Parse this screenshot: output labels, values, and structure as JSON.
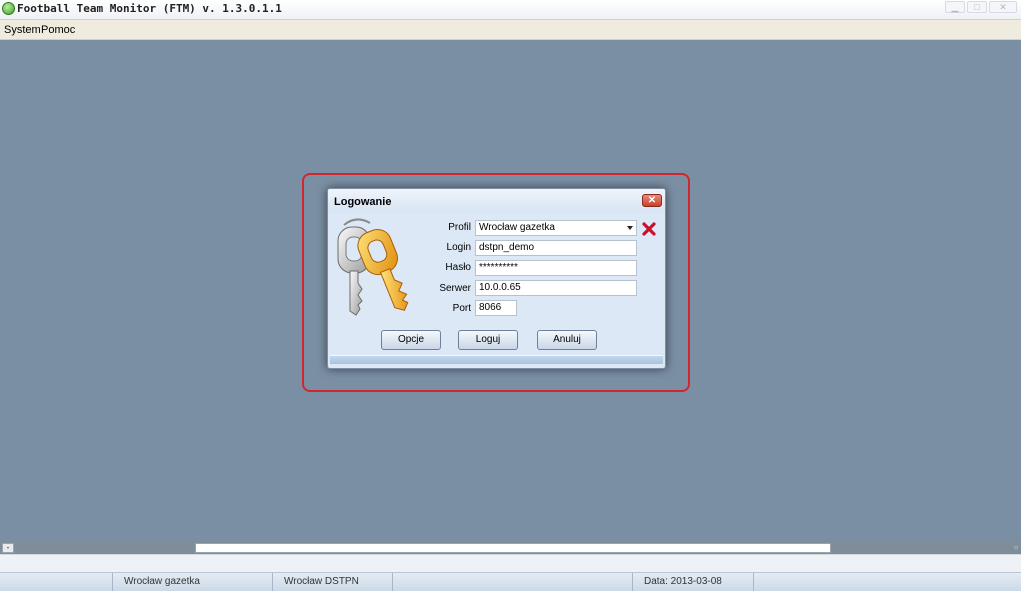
{
  "window": {
    "title": "Football Team Monitor (FTM)  v. 1.3.0.1.1"
  },
  "menu": {
    "items": [
      "System",
      "Pomoc"
    ]
  },
  "dialog": {
    "title": "Logowanie",
    "labels": {
      "profil": "Profil",
      "login": "Login",
      "haslo": "Hasło",
      "serwer": "Serwer",
      "port": "Port"
    },
    "values": {
      "profil": "Wrocław gazetka",
      "login": "dstpn_demo",
      "haslo": "**********",
      "serwer": "10.0.0.65",
      "port": "8066"
    },
    "buttons": {
      "opcje": "Opcje",
      "loguj": "Loguj",
      "anuluj": "Anuluj"
    }
  },
  "statusbar": {
    "panel1": "Wrocław gazetka",
    "panel2": "Wrocław DSTPN",
    "panel3": "",
    "panel4": "Data: 2013-03-08",
    "panel5": ""
  },
  "colors": {
    "desktop": "#7b8fa4",
    "highlight": "#d0262e",
    "dialog_bg": "#dce8f5"
  },
  "icons": {
    "app": "ftm-app-icon",
    "keys": "keys-icon",
    "clear": "red-x-icon",
    "close": "close-icon"
  }
}
